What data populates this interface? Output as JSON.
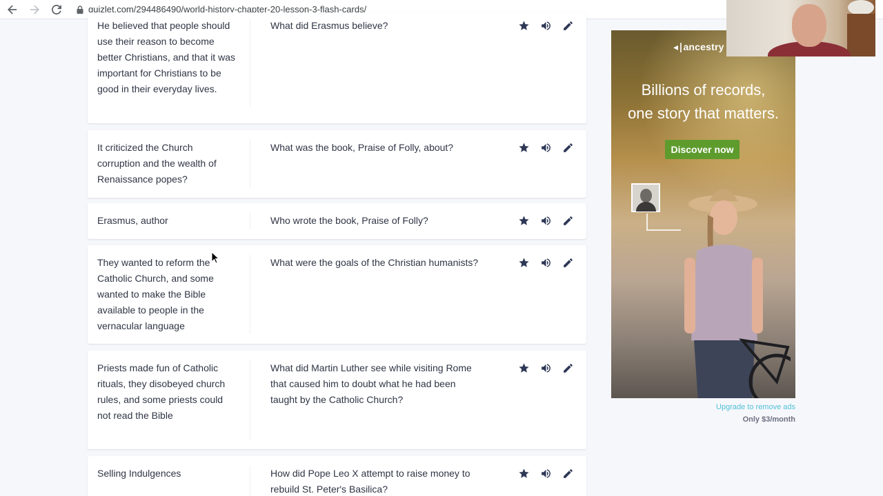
{
  "browser": {
    "url": "quizlet.com/294486490/world-history-chapter-20-lesson-3-flash-cards/"
  },
  "cards": [
    {
      "definition": "He believed that people should use their reason to become better Christians, and that it was important for Christians to be good in their everyday lives.",
      "term": "What did Erasmus believe?"
    },
    {
      "definition": "It criticized the Church corruption and the wealth of Renaissance popes?",
      "term": "What was the book, Praise of Folly, about?"
    },
    {
      "definition": "Erasmus, author",
      "term": "Who wrote the book, Praise of Folly?"
    },
    {
      "definition": "They wanted to reform the Catholic Church, and some wanted to make the Bible available to people in the vernacular language",
      "term": "What were the goals of the Christian humanists?"
    },
    {
      "definition": "Priests made fun of Catholic rituals, they disobeyed church rules, and some priests could not read the Bible",
      "term": "What did Martin Luther see while visiting Rome that caused him to doubt what he had been taught by the Catholic Church?"
    },
    {
      "definition": "Selling Indulgences",
      "term": "How did Pope Leo X attempt to raise money to rebuild St. Peter's Basilica?"
    }
  ],
  "card_actions": [
    "star-icon",
    "speaker-icon",
    "pencil-icon"
  ],
  "ad": {
    "logo": "ancestry",
    "headline_line1": "Billions of records,",
    "headline_line2": "one story that matters.",
    "cta": "Discover now",
    "upgrade_link": "Upgrade to remove ads",
    "price": "Only $3/month"
  },
  "colors": {
    "page_bg": "#f6f7fb",
    "icon": "#2e3856",
    "ad_cta": "#5e9b2d",
    "upgrade_link": "#4fc1d6"
  }
}
